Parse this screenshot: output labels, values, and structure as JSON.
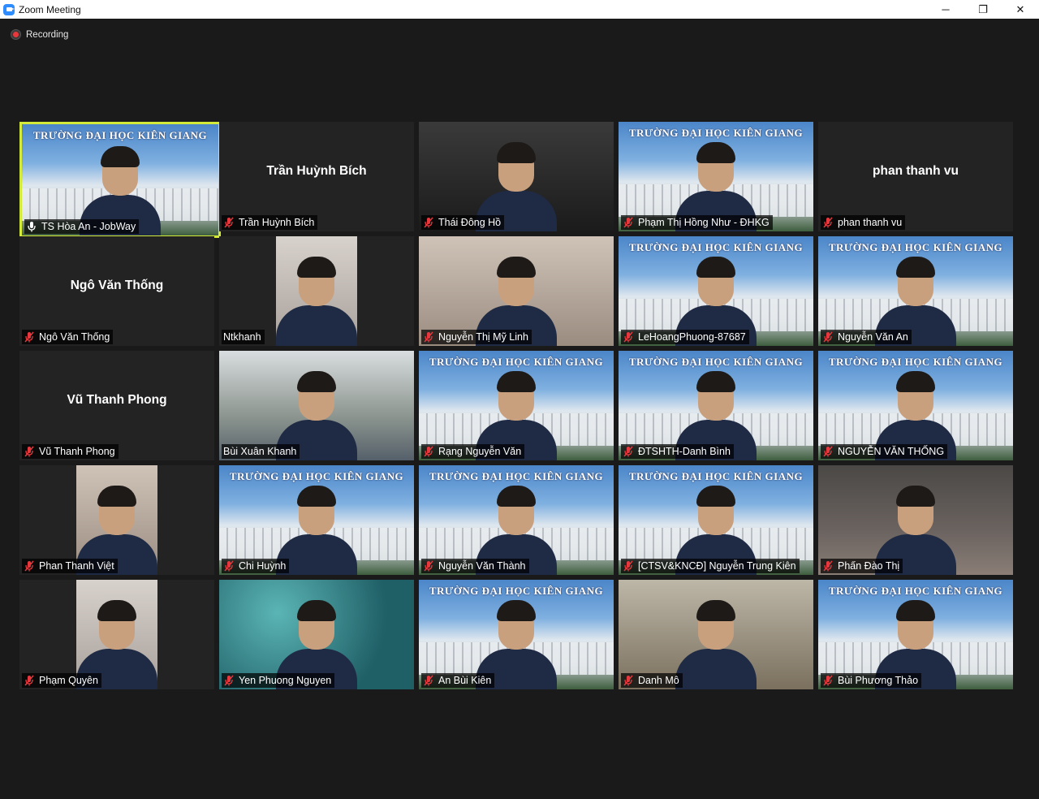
{
  "window": {
    "title": "Zoom Meeting",
    "controls": {
      "minimize": "─",
      "restore": "❐",
      "close": "✕"
    }
  },
  "recording": {
    "label": "Recording",
    "color": "#e8383d"
  },
  "colors": {
    "active_speaker_border": "#d3ea3a",
    "muted_mic": "#e8383d",
    "background": "#1a1a1a"
  },
  "campus_banner": "TRƯỜNG ĐẠI HỌC KIÊN GIANG",
  "participants": [
    {
      "name": "TS Hòa An - JobWay",
      "video": "campus",
      "mic": "on",
      "active": true
    },
    {
      "name": "Trần Huỳnh Bích",
      "video": "off",
      "center_name": "Trần Huỳnh Bích",
      "mic": "muted"
    },
    {
      "name": "Thái Đông Hồ",
      "video": "dark",
      "mic": "muted"
    },
    {
      "name": "Phạm Thị Hồng Như - ĐHKG",
      "video": "campus",
      "mic": "muted"
    },
    {
      "name": "phan thanh vu",
      "video": "off",
      "center_name": "phan thanh vu",
      "mic": "muted"
    },
    {
      "name": "Ngô Văn Thống",
      "video": "off",
      "center_name": "Ngô Văn Thống",
      "mic": "muted"
    },
    {
      "name": "Ntkhanh",
      "video": "room",
      "mic": "none"
    },
    {
      "name": "Nguyễn Thị Mỹ Linh",
      "video": "room",
      "mic": "muted"
    },
    {
      "name": "LeHoangPhuong-87687",
      "video": "campus",
      "mic": "muted"
    },
    {
      "name": "Nguyễn Văn An",
      "video": "campus",
      "mic": "muted"
    },
    {
      "name": "Vũ Thanh Phong",
      "video": "off",
      "center_name": "Vũ Thanh Phong",
      "mic": "muted"
    },
    {
      "name": "Bùi Xuân Khanh",
      "video": "tree",
      "mic": "none"
    },
    {
      "name": "Rạng Nguyễn Văn",
      "video": "campus",
      "mic": "muted"
    },
    {
      "name": "ĐTSHTH-Danh Bình",
      "video": "campus",
      "mic": "muted"
    },
    {
      "name": "NGUYỄN VĂN THỐNG",
      "video": "campus",
      "mic": "muted"
    },
    {
      "name": "Phan Thanh Việt",
      "video": "room",
      "mic": "muted"
    },
    {
      "name": "Chi Huỳnh",
      "video": "campus",
      "mic": "muted"
    },
    {
      "name": "Nguyễn Văn Thành",
      "video": "campus",
      "mic": "muted"
    },
    {
      "name": "[CTSV&KNCĐ] Nguyễn Trung Kiên",
      "video": "campus",
      "mic": "muted"
    },
    {
      "name": "Phấn Đào Thị",
      "video": "blur",
      "mic": "muted"
    },
    {
      "name": "Phạm Quyên",
      "video": "room",
      "mic": "muted"
    },
    {
      "name": "Yen Phuong Nguyen",
      "video": "teal",
      "mic": "muted"
    },
    {
      "name": "An Bùi Kiên",
      "video": "campus",
      "mic": "muted"
    },
    {
      "name": "Danh Mô",
      "video": "office",
      "mic": "muted"
    },
    {
      "name": "Bùi Phương Thảo",
      "video": "campus",
      "mic": "muted"
    }
  ]
}
